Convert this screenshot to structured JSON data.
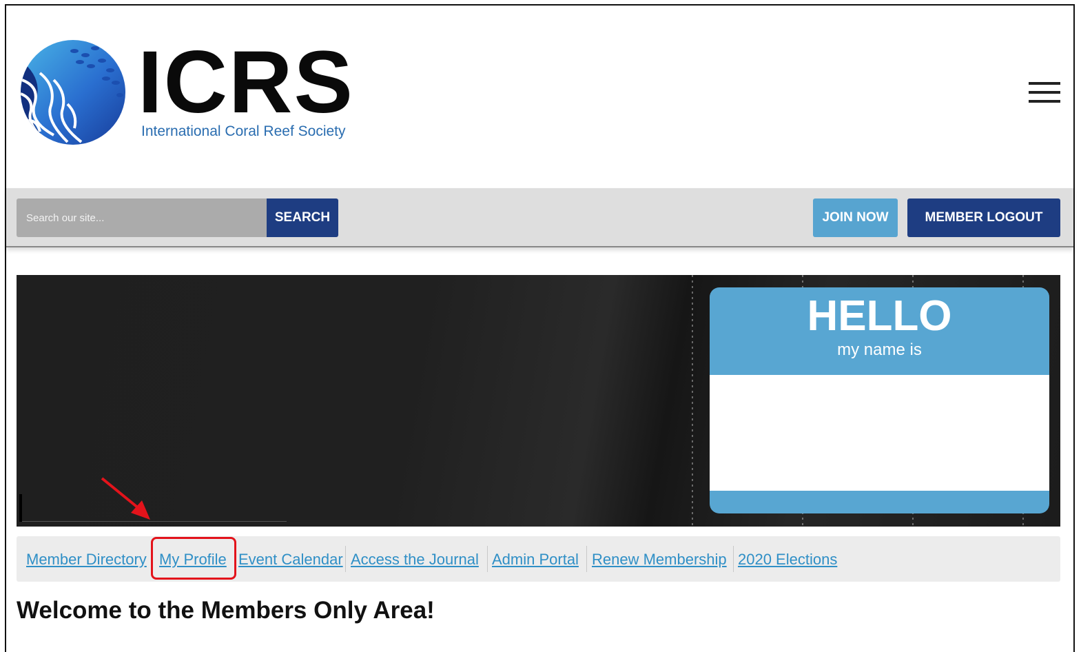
{
  "header": {
    "logo_title": "ICRS",
    "logo_subtitle": "International Coral Reef Society",
    "menu_icon": "hamburger-menu-icon"
  },
  "toolbar": {
    "search_placeholder": "Search our site...",
    "search_label": "SEARCH",
    "join_label": "JOIN NOW",
    "logout_label": "MEMBER LOGOUT"
  },
  "banner": {
    "hello": "HELLO",
    "my_name_is": "my name is"
  },
  "nav": {
    "items": [
      {
        "label": "Member Directory"
      },
      {
        "label": "My Profile"
      },
      {
        "label": "Event Calendar"
      },
      {
        "label": "Access the Journal"
      },
      {
        "label": "Admin Portal"
      },
      {
        "label": "Renew Membership"
      },
      {
        "label": "2020 Elections"
      }
    ]
  },
  "main": {
    "heading": "Welcome to the Members Only Area!"
  },
  "colors": {
    "primary_dark_blue": "#1e3d82",
    "accent_light_blue": "#57a4d0",
    "link_blue": "#2f8fc6",
    "highlight_red": "#e3131b"
  }
}
